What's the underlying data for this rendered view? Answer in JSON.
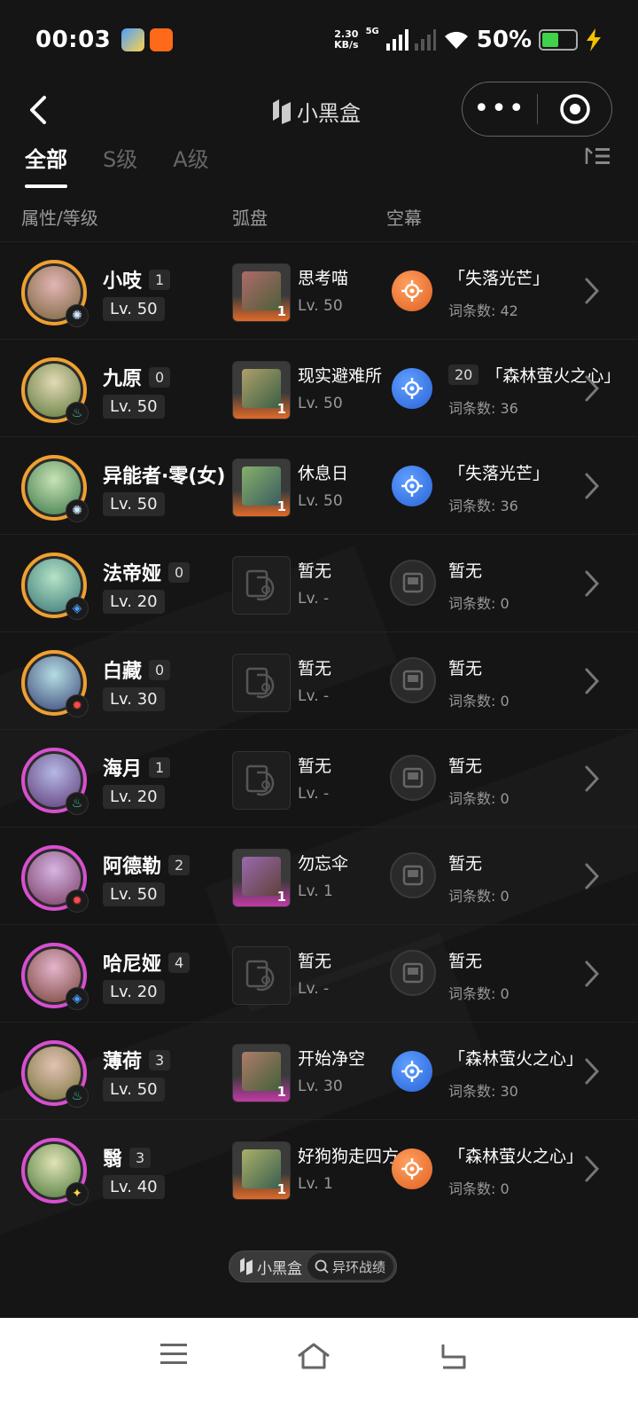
{
  "status": {
    "time": "00:03",
    "net_speed_value": "2.30",
    "net_speed_unit": "KB/s",
    "network": "5G",
    "battery": "50%",
    "battery_level": 0.5
  },
  "header": {
    "title": "小黑盒"
  },
  "tabs": [
    {
      "label": "全部",
      "active": true
    },
    {
      "label": "S级",
      "active": false
    },
    {
      "label": "A级",
      "active": false
    }
  ],
  "columns": {
    "attr_level": "属性/等级",
    "disc": "弧盘",
    "screen": "空幕"
  },
  "rows": [
    {
      "name": "小吱",
      "rank": "1",
      "level": "Lv. 50",
      "ring": "orange",
      "element": "light",
      "element_color": "#cfe8ff",
      "disc": {
        "name": "思考喵",
        "level": "Lv. 50",
        "count": "1",
        "style": "orange"
      },
      "screen": {
        "prefix": "",
        "name": "「失落光芒」",
        "count": "词条数: 42",
        "style": "orange"
      }
    },
    {
      "name": "九原",
      "rank": "0",
      "level": "Lv. 50",
      "ring": "orange",
      "element": "wind",
      "element_color": "#3fd0a0",
      "disc": {
        "name": "现实避难所",
        "level": "Lv. 50",
        "count": "1",
        "style": "orange"
      },
      "screen": {
        "prefix": "20",
        "name": "「森林萤火之心」",
        "count": "词条数: 36",
        "style": "blue"
      }
    },
    {
      "name": "异能者·零(女)",
      "rank": "",
      "level": "Lv. 50",
      "ring": "orange",
      "element": "light",
      "element_color": "#cfe8ff",
      "disc": {
        "name": "休息日",
        "level": "Lv. 50",
        "count": "1",
        "style": "orange"
      },
      "screen": {
        "prefix": "",
        "name": "「失落光芒」",
        "count": "词条数: 36",
        "style": "blue"
      }
    },
    {
      "name": "法帝娅",
      "rank": "0",
      "level": "Lv. 20",
      "ring": "orange",
      "element": "water",
      "element_color": "#4aa0ff",
      "disc": {
        "name": "暂无",
        "level": "Lv. -",
        "count": "",
        "style": "empty"
      },
      "screen": {
        "prefix": "",
        "name": "暂无",
        "count": "词条数: 0",
        "style": "empty"
      }
    },
    {
      "name": "白藏",
      "rank": "0",
      "level": "Lv. 30",
      "ring": "orange",
      "element": "fire",
      "element_color": "#ff4a4a",
      "disc": {
        "name": "暂无",
        "level": "Lv. -",
        "count": "",
        "style": "empty"
      },
      "screen": {
        "prefix": "",
        "name": "暂无",
        "count": "词条数: 0",
        "style": "empty"
      }
    },
    {
      "name": "海月",
      "rank": "1",
      "level": "Lv. 20",
      "ring": "pink",
      "element": "wind",
      "element_color": "#3fd0a0",
      "disc": {
        "name": "暂无",
        "level": "Lv. -",
        "count": "",
        "style": "empty"
      },
      "screen": {
        "prefix": "",
        "name": "暂无",
        "count": "词条数: 0",
        "style": "empty"
      }
    },
    {
      "name": "阿德勒",
      "rank": "2",
      "level": "Lv. 50",
      "ring": "pink",
      "element": "fire",
      "element_color": "#ff4a4a",
      "disc": {
        "name": "勿忘伞",
        "level": "Lv. 1",
        "count": "1",
        "style": "purple"
      },
      "screen": {
        "prefix": "",
        "name": "暂无",
        "count": "词条数: 0",
        "style": "empty"
      }
    },
    {
      "name": "哈尼娅",
      "rank": "4",
      "level": "Lv. 20",
      "ring": "pink",
      "element": "water",
      "element_color": "#4aa0ff",
      "disc": {
        "name": "暂无",
        "level": "Lv. -",
        "count": "",
        "style": "empty"
      },
      "screen": {
        "prefix": "",
        "name": "暂无",
        "count": "词条数: 0",
        "style": "empty"
      }
    },
    {
      "name": "薄荷",
      "rank": "3",
      "level": "Lv. 50",
      "ring": "pink",
      "element": "wind",
      "element_color": "#3fd0a0",
      "disc": {
        "name": "开始净空",
        "level": "Lv. 30",
        "count": "1",
        "style": "purple"
      },
      "screen": {
        "prefix": "",
        "name": "「森林萤火之心」",
        "count": "词条数: 30",
        "style": "blue"
      }
    },
    {
      "name": "翳",
      "rank": "3",
      "level": "Lv. 40",
      "ring": "pink",
      "element": "cosmos",
      "element_color": "#ffd84a",
      "disc": {
        "name": "好狗狗走四方",
        "level": "Lv. 1",
        "count": "1",
        "style": "orange"
      },
      "screen": {
        "prefix": "",
        "name": "「森林萤火之心」",
        "count": "词条数: 0",
        "style": "orange"
      }
    }
  ],
  "footer_badge": {
    "brand": "小黑盒",
    "search_label": "异环战绩"
  },
  "colors": {
    "background": "#151515",
    "ring_orange": "#f0a030",
    "ring_pink": "#d94fd0",
    "screen_orange": "#e06020",
    "screen_blue": "#2a62d8",
    "battery_green": "#3fd24a"
  },
  "icons": {
    "back": "chevron-left-icon",
    "more": "more-dots-icon",
    "target": "target-circle-icon",
    "filter": "filter-list-icon",
    "row_chevron": "chevron-right-icon",
    "nav_menu": "menu-icon",
    "nav_home": "home-icon",
    "nav_back": "return-icon"
  }
}
